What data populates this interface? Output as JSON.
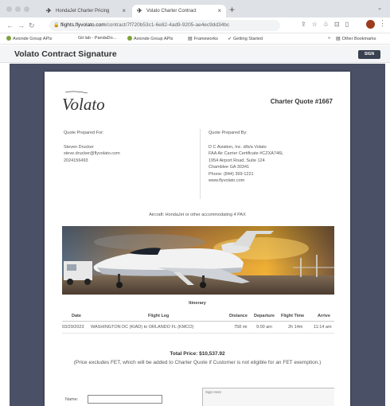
{
  "browser": {
    "tabs": [
      {
        "label": "HondaJet Charter Pricing",
        "active": false
      },
      {
        "label": "Volato Charter Contract",
        "active": true
      }
    ],
    "new_tab": "+",
    "url_host": "flights.flyvolato.com",
    "url_path": "/contract/7f720b53c1-6e82-4ad9-9205-ae4ec9dd34bc",
    "bookmarks": [
      {
        "label": "Avionde Group APIs",
        "icon": "globe-dot"
      },
      {
        "label": "Git lab - PandaDo...",
        "icon": "none"
      },
      {
        "label": "Avionde Group APIs",
        "icon": "globe-dot"
      },
      {
        "label": "Frameworks",
        "icon": "folder"
      },
      {
        "label": "Getting Started",
        "icon": "rocket"
      }
    ],
    "other_bookmarks": "Other Bookmarks",
    "bookmarks_overflow": "»"
  },
  "app": {
    "title": "Volato Contract Signature",
    "sign_label": "SIGN"
  },
  "document": {
    "logo_text": "Volato",
    "quote_title": "Charter Quote #1667",
    "prepared_for": {
      "label": "Quote Prepared For:",
      "name": "Steven Drucker",
      "email": "steve.drucker@flyvolato.com",
      "phone": "2024156493"
    },
    "prepared_by": {
      "label": "Quote Prepared By:",
      "lines": [
        "D C Aviation, Inc. d/b/a Volato",
        "FAA Air Carrier Certificate #CZXA746L",
        "1954 Airport Road, Suite 124",
        "Chamblee GA 30341",
        "Phone: (844) 399-1221",
        "www.flyvolato.com"
      ]
    },
    "aircraft": "Aircraft: HondaJet or other accommodating 4 PAX",
    "itinerary": {
      "title": "Itinerary",
      "headers": [
        "Date",
        "Flight Leg",
        "Distance",
        "Departure",
        "Flight Time",
        "Arrive"
      ],
      "rows": [
        [
          "03/29/2023",
          "WASHINGTON DC (KIAD) to ORLANDO FL (KMCO)",
          "758 mi",
          "9:00 am",
          "2h 14m",
          "11:14 am"
        ]
      ]
    },
    "total_price": "Total Price: $10,537.92",
    "price_note": "(Price excludes FET, which will be added to Charter Quote if Customer is not eligible for an FET exemption.)",
    "name_label": "Name:",
    "name_value": "",
    "signature_label": "Sign Here"
  },
  "colors": {
    "viewer_bg": "#4a5066",
    "sign_button": "#3a4150",
    "tab_bar": "#dee1e6"
  }
}
